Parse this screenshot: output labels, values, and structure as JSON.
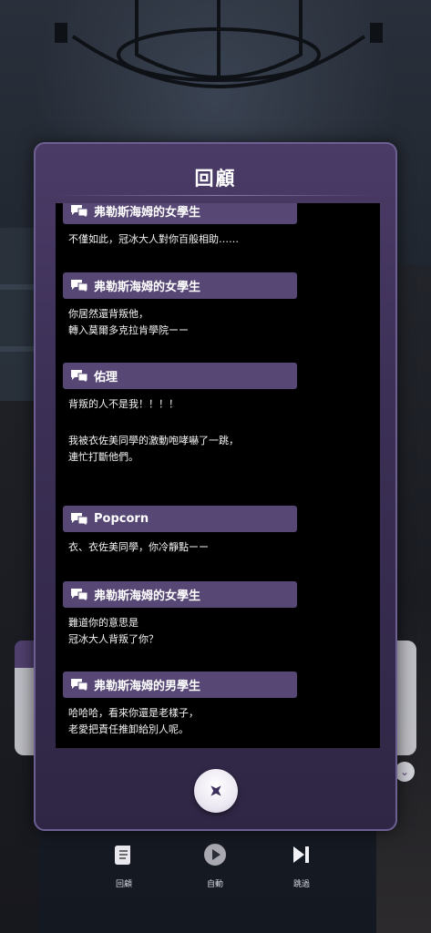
{
  "panel": {
    "title": "回顧"
  },
  "log": [
    {
      "speaker": "弗勒斯海姆的女學生",
      "text": "不僅如此，冠冰大人對你百般相助……"
    },
    {
      "speaker": "弗勒斯海姆的女學生",
      "text": "你居然還背叛他，\n轉入莫爾多克拉肯學院ーー"
    },
    {
      "speaker": "佑理",
      "text": "背叛的人不是我！！！！",
      "narration": "我被衣佐美同學的激動咆哮嚇了一跳，\n連忙打斷他們。"
    },
    {
      "speaker": "Popcorn",
      "text": "衣、衣佐美同學，你冷靜點ーー"
    },
    {
      "speaker": "弗勒斯海姆的女學生",
      "text": "難道你的意思是\n冠冰大人背叛了你？"
    },
    {
      "speaker": "弗勒斯海姆的男學生",
      "text": "哈哈哈，看來你還是老樣子，\n老愛把責任推卸給別人呢。"
    }
  ],
  "controls": {
    "review_label": "回顧",
    "auto_label": "自動",
    "skip_label": "跳過"
  },
  "icons": {
    "speaker": "speech-bubble-icon",
    "close": "close-x-icon",
    "review": "scroll-icon",
    "auto": "play-icon",
    "skip": "skip-forward-icon"
  },
  "colors": {
    "panel": "#3b2f55",
    "speaker_bar": "#574775",
    "log_bg": "#000000"
  }
}
